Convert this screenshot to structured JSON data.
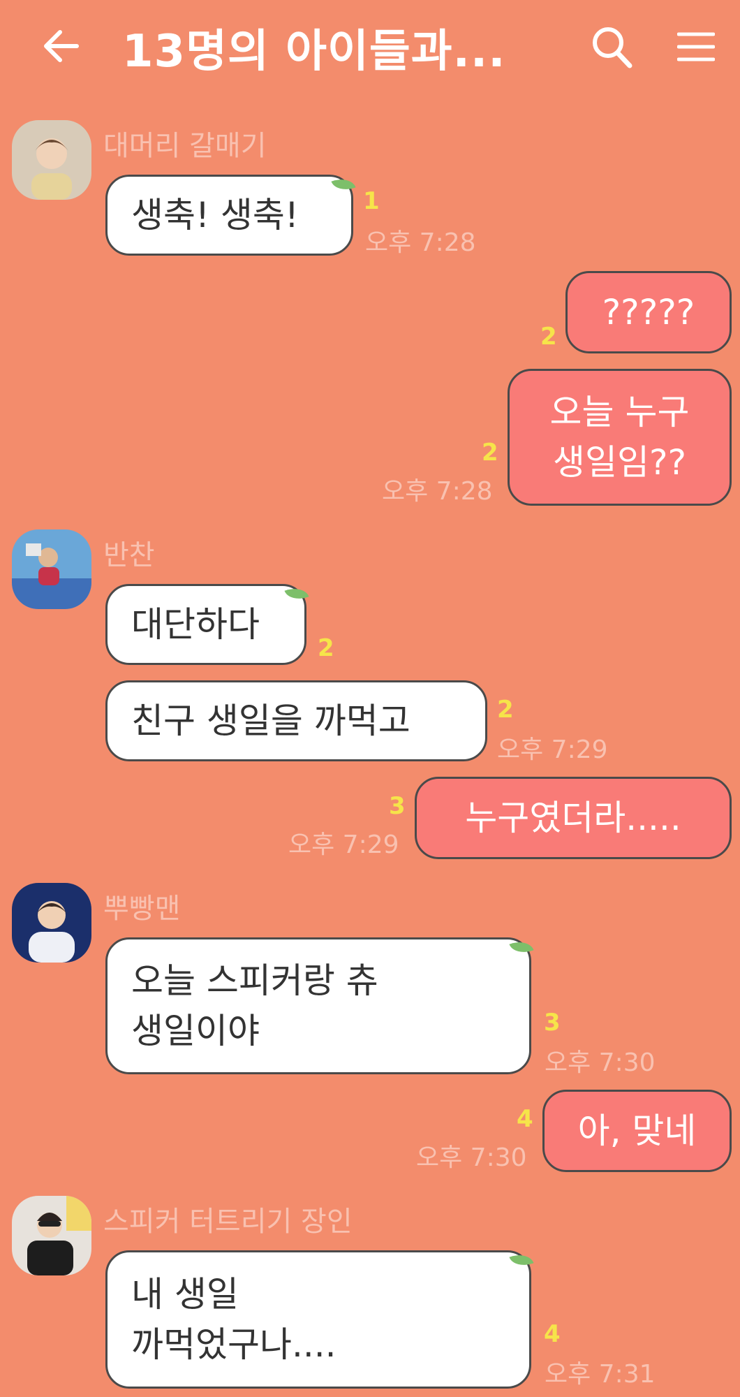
{
  "header": {
    "title": "13명의 아이들과..."
  },
  "messages": {
    "m1": {
      "sender": "대머리 갈매기",
      "text": "생축! 생축!",
      "count": "1",
      "time": "오후 7:28"
    },
    "m2": {
      "text": "?????",
      "count": "2"
    },
    "m3": {
      "line1": "오늘 누구",
      "line2": "생일임??",
      "count": "2",
      "time": "오후 7:28"
    },
    "m4": {
      "sender": "반찬",
      "text": "대단하다",
      "count": "2"
    },
    "m5": {
      "text": "친구 생일을 까먹고",
      "count": "2",
      "time": "오후 7:29"
    },
    "m6": {
      "text": "누구였더라.....",
      "count": "3",
      "time": "오후 7:29"
    },
    "m7": {
      "sender": "뿌빵맨",
      "line1": "오늘 스피커랑 츄",
      "line2": "생일이야",
      "count": "3",
      "time": "오후 7:30"
    },
    "m8": {
      "text": "아, 맞네",
      "count": "4",
      "time": "오후 7:30"
    },
    "m9": {
      "sender": "스피커 터트리기 장인",
      "line1": "내 생일",
      "line2": "까먹었구나....",
      "count": "4",
      "time": "오후 7:31"
    }
  },
  "colors": {
    "background": "#f38c6c",
    "my_bubble": "#f97b77",
    "other_bubble": "#ffffff",
    "unread": "#f6e44a"
  },
  "icons": {
    "back": "arrow-left-icon",
    "search": "search-icon",
    "menu": "hamburger-menu-icon"
  }
}
